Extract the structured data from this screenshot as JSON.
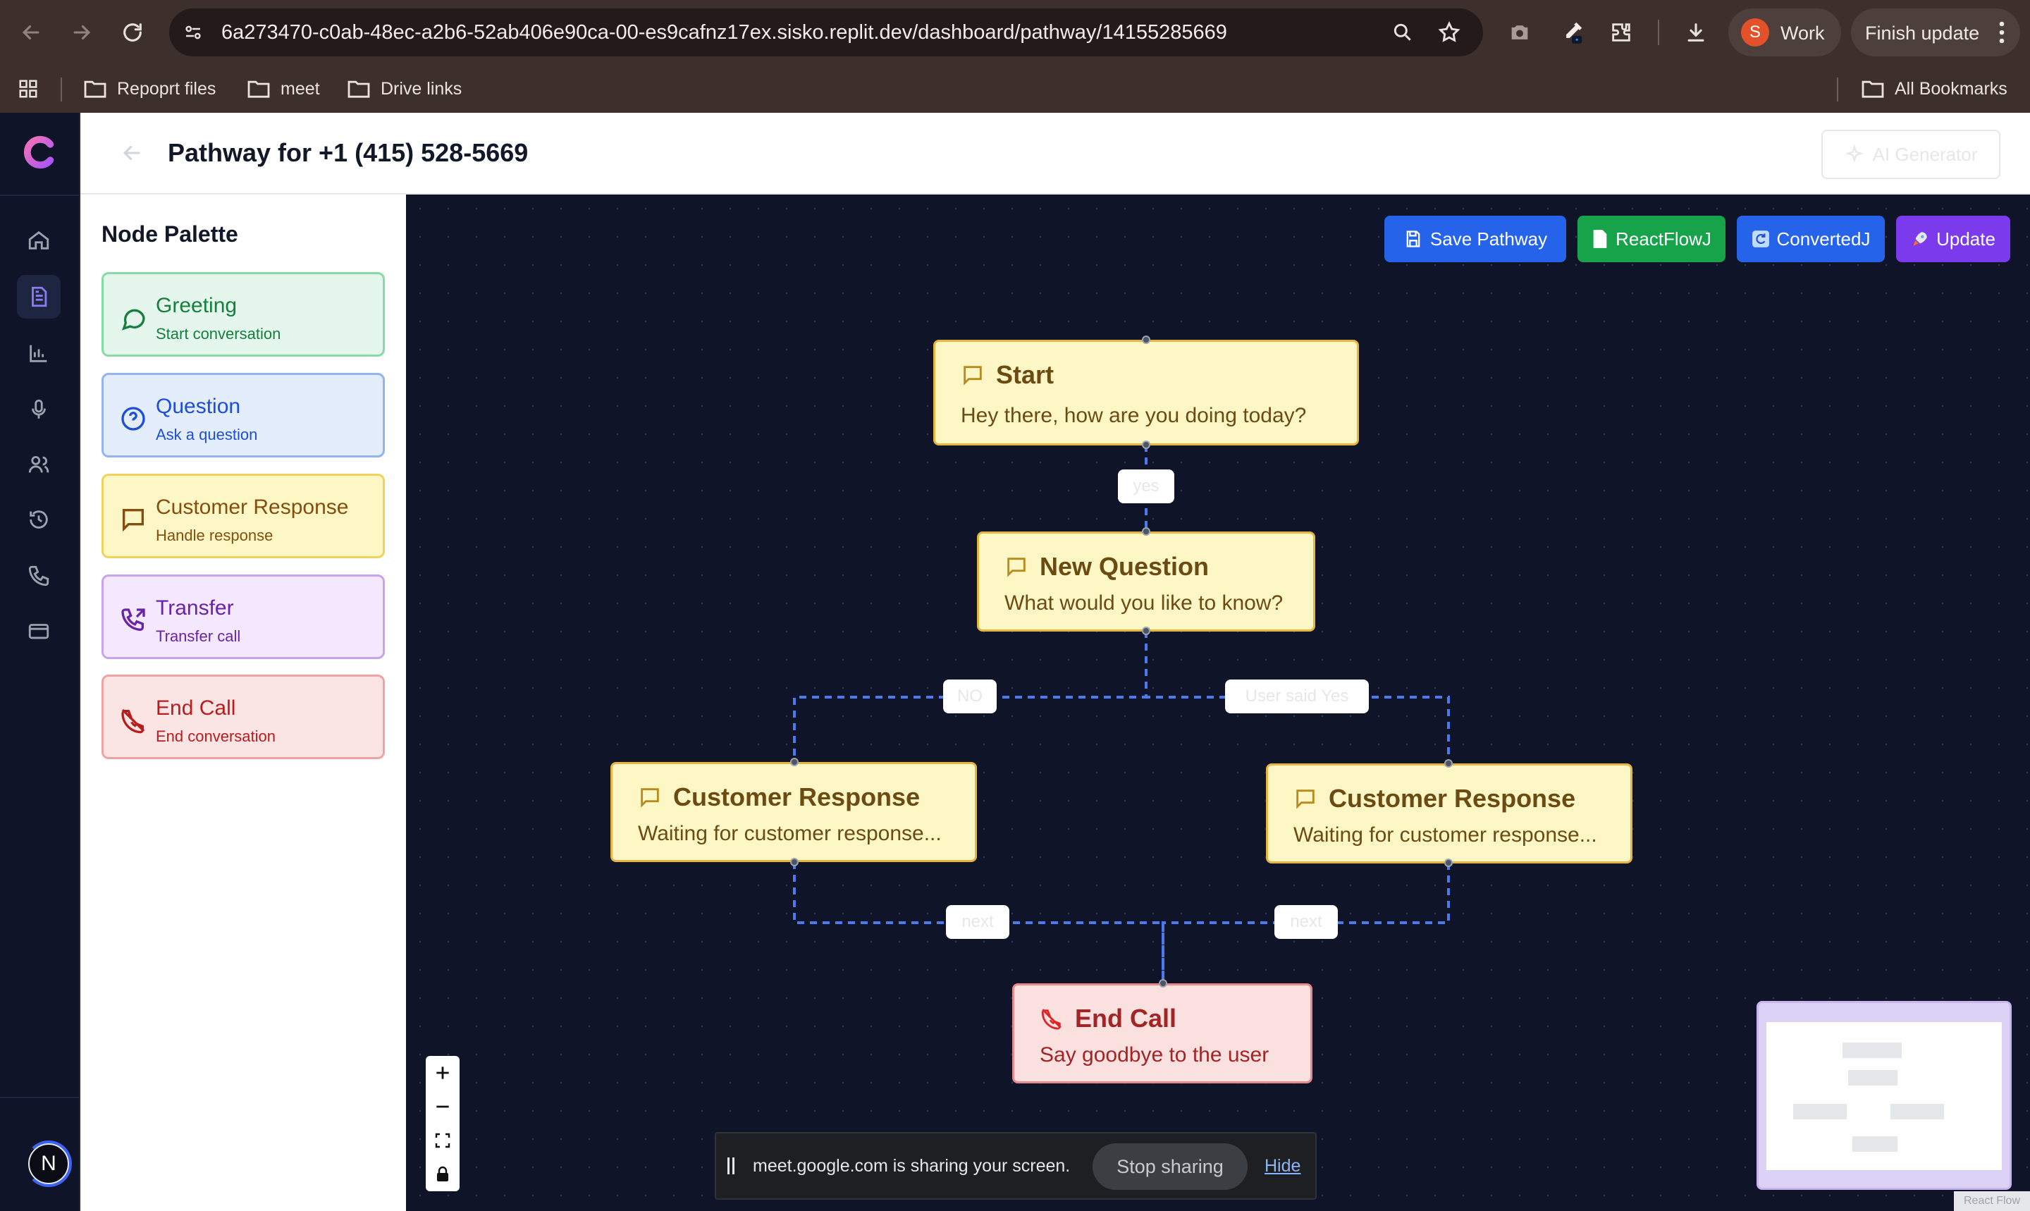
{
  "browser": {
    "url": "6a273470-c0ab-48ec-a2b6-52ab406e90ca-00-es9cafnz17ex.sisko.replit.dev/dashboard/pathway/14155285669",
    "profile_initial": "S",
    "profile_label": "Work",
    "finish_update_label": "Finish update",
    "bookmarks": [
      "Repoprt files",
      "meet",
      "Drive links"
    ],
    "all_bookmarks_label": "All Bookmarks"
  },
  "header": {
    "title": "Pathway for +1 (415) 528-5669",
    "ai_generator_label": "AI Generator"
  },
  "rail": {
    "icons": [
      "home-icon",
      "document-icon",
      "bar-chart-icon",
      "microphone-icon",
      "users-icon",
      "history-icon",
      "phone-icon",
      "credit-card-icon"
    ],
    "user_initial": "N"
  },
  "palette": {
    "title": "Node Palette",
    "items": [
      {
        "label": "Greeting",
        "sub": "Start conversation",
        "icon": "message-circle-icon",
        "color": "#15803d"
      },
      {
        "label": "Question",
        "sub": "Ask a question",
        "icon": "help-circle-icon",
        "color": "#1d4ed8"
      },
      {
        "label": "Customer Response",
        "sub": "Handle response",
        "icon": "message-square-icon",
        "color": "#854d0e"
      },
      {
        "label": "Transfer",
        "sub": "Transfer call",
        "icon": "phone-forwarded-icon",
        "color": "#6b21a8"
      },
      {
        "label": "End Call",
        "sub": "End conversation",
        "icon": "phone-off-icon",
        "color": "#b91c1c"
      }
    ]
  },
  "toolbar": {
    "save_label": "Save Pathway",
    "reactflow_label": "ReactFlowJ",
    "converted_label": "ConvertedJ",
    "update_label": "Update",
    "colors": {
      "save": "#2563eb",
      "reactflow": "#16a34a",
      "converted": "#2563eb",
      "update": "#7c3aed"
    }
  },
  "nodes": {
    "start": {
      "title": "Start",
      "body": "Hey there, how are you doing today?"
    },
    "question": {
      "title": "New Question",
      "body": "What would you like to know?"
    },
    "response_left": {
      "title": "Customer Response",
      "body": "Waiting for customer response..."
    },
    "response_right": {
      "title": "Customer Response",
      "body": "Waiting for customer response..."
    },
    "end": {
      "title": "End Call",
      "body": "Say goodbye to the user"
    }
  },
  "edges": {
    "start_to_question": "yes",
    "question_to_left": "NO",
    "question_to_right": "User said Yes",
    "left_to_end": "next",
    "right_to_end": "next"
  },
  "share_bar": {
    "message": "meet.google.com is sharing your screen.",
    "stop_label": "Stop sharing",
    "hide_label": "Hide"
  },
  "attribution": "React Flow"
}
